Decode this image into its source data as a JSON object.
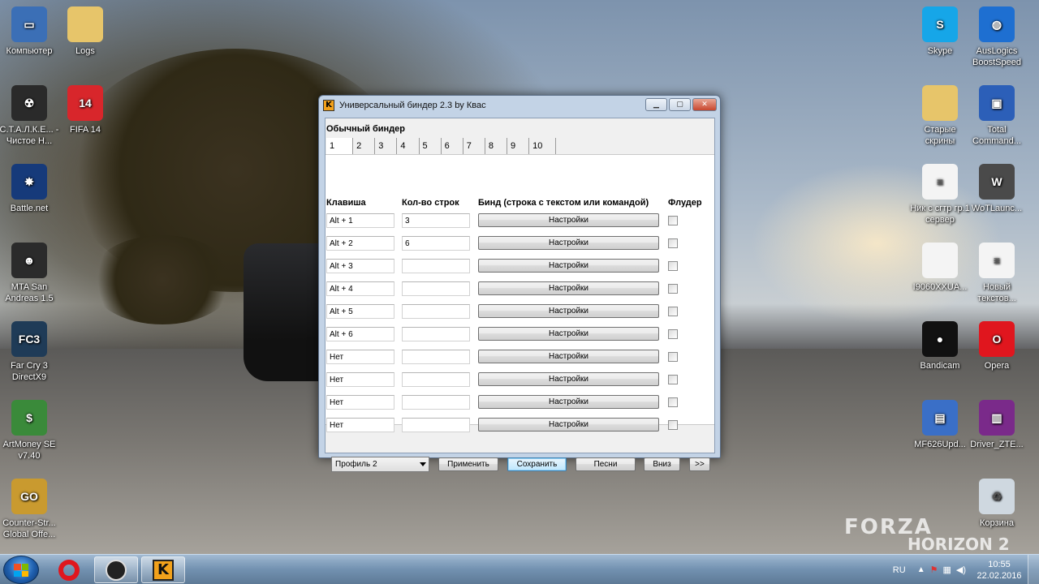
{
  "desktop": {
    "icons_left": [
      {
        "label": "Компьютер",
        "icon": "computer-icon",
        "color": "#3b6fb6",
        "glyph": "▭"
      },
      {
        "label": "Logs",
        "icon": "folder-icon",
        "color": "#e7c56a",
        "glyph": ""
      },
      {
        "label": "С.Т.А.Л.К.Е... - Чистое Н...",
        "icon": "stalker-icon",
        "color": "#2a2a2a",
        "glyph": "☢"
      },
      {
        "label": "FIFA 14",
        "icon": "fifa-icon",
        "color": "#d8262b",
        "glyph": "14"
      },
      {
        "label": "Battle.net",
        "icon": "battlenet-icon",
        "color": "#163a7a",
        "glyph": "✸"
      },
      {
        "label": "MTA San Andreas 1.5",
        "icon": "mta-icon",
        "color": "#2b2b2b",
        "glyph": "☻"
      },
      {
        "label": "Far Cry 3 DirectX9",
        "icon": "farcry-icon",
        "color": "#1f3b57",
        "glyph": "FC3"
      },
      {
        "label": "ArtMoney SE v7.40",
        "icon": "artmoney-icon",
        "color": "#3a8a3a",
        "glyph": "$"
      },
      {
        "label": "Counter-Str... Global Offe...",
        "icon": "csgo-icon",
        "color": "#c99a2f",
        "glyph": "GO"
      }
    ],
    "icons_right": [
      {
        "label": "Skype",
        "icon": "skype-icon",
        "color": "#16a6e8",
        "glyph": "S"
      },
      {
        "label": "AusLogics BoostSpeed",
        "icon": "globe-icon",
        "color": "#1e6fd1",
        "glyph": "◍"
      },
      {
        "label": "Старые скрины",
        "icon": "folder-icon",
        "color": "#e7c56a",
        "glyph": ""
      },
      {
        "label": "Total Command...",
        "icon": "floppy-icon",
        "color": "#2c5fb8",
        "glyph": "▣"
      },
      {
        "label": "Ник с сгтр гр.1 сервер",
        "icon": "text-file-icon",
        "color": "#f4f4f4",
        "glyph": "≡"
      },
      {
        "label": "WoTLaunc...",
        "icon": "wot-icon",
        "color": "#4a4a4a",
        "glyph": "W"
      },
      {
        "label": "I9060XXUA...",
        "icon": "file-icon",
        "color": "#f4f4f4",
        "glyph": ""
      },
      {
        "label": "Новый текстов...",
        "icon": "text-file-icon",
        "color": "#f4f4f4",
        "glyph": "≡"
      },
      {
        "label": "Bandicam",
        "icon": "bandicam-icon",
        "color": "#111111",
        "glyph": "●"
      },
      {
        "label": "Opera",
        "icon": "opera-icon",
        "color": "#e0161e",
        "glyph": "O"
      },
      {
        "label": "MF626Upd...",
        "icon": "modem-icon",
        "color": "#3a6fc7",
        "glyph": "▤"
      },
      {
        "label": "Driver_ZTE...",
        "icon": "winrar-icon",
        "color": "#7a2a8a",
        "glyph": "▥"
      },
      {
        "label": "Корзина",
        "icon": "recycle-bin-icon",
        "color": "#cfd8e0",
        "glyph": "♻"
      }
    ],
    "watermark_line1": "FORZA",
    "watermark_line2": "HORIZON 2"
  },
  "window": {
    "title": "Универсальный биндер 2.3 by Квас",
    "app_icon_letter": "K",
    "section_title": "Обычный биндер",
    "tabs": [
      "1",
      "2",
      "3",
      "4",
      "5",
      "6",
      "7",
      "8",
      "9",
      "10"
    ],
    "headers": {
      "key": "Клавиша",
      "count": "Кол-во строк",
      "bind": "Бинд (строка с текстом или командой)",
      "flood": "Флудер"
    },
    "rows": [
      {
        "key": "Alt + 1",
        "count": "3",
        "button": "Настройки",
        "flood": false
      },
      {
        "key": "Alt + 2",
        "count": "6",
        "button": "Настройки",
        "flood": false
      },
      {
        "key": "Alt + 3",
        "count": "",
        "button": "Настройки",
        "flood": false
      },
      {
        "key": "Alt + 4",
        "count": "",
        "button": "Настройки",
        "flood": false
      },
      {
        "key": "Alt + 5",
        "count": "",
        "button": "Настройки",
        "flood": false
      },
      {
        "key": "Alt + 6",
        "count": "",
        "button": "Настройки",
        "flood": false
      },
      {
        "key": "Нет",
        "count": "",
        "button": "Настройки",
        "flood": false
      },
      {
        "key": "Нет",
        "count": "",
        "button": "Настройки",
        "flood": false
      },
      {
        "key": "Нет",
        "count": "",
        "button": "Настройки",
        "flood": false
      },
      {
        "key": "Нет",
        "count": "",
        "button": "Настройки",
        "flood": false
      }
    ],
    "footer": {
      "profile": "Профиль 2",
      "apply": "Применить",
      "save": "Сохранить",
      "songs": "Песни",
      "down": "Вниз",
      "more": ">>"
    }
  },
  "taskbar": {
    "lang": "RU",
    "time": "10:55",
    "date": "22.02.2016"
  }
}
